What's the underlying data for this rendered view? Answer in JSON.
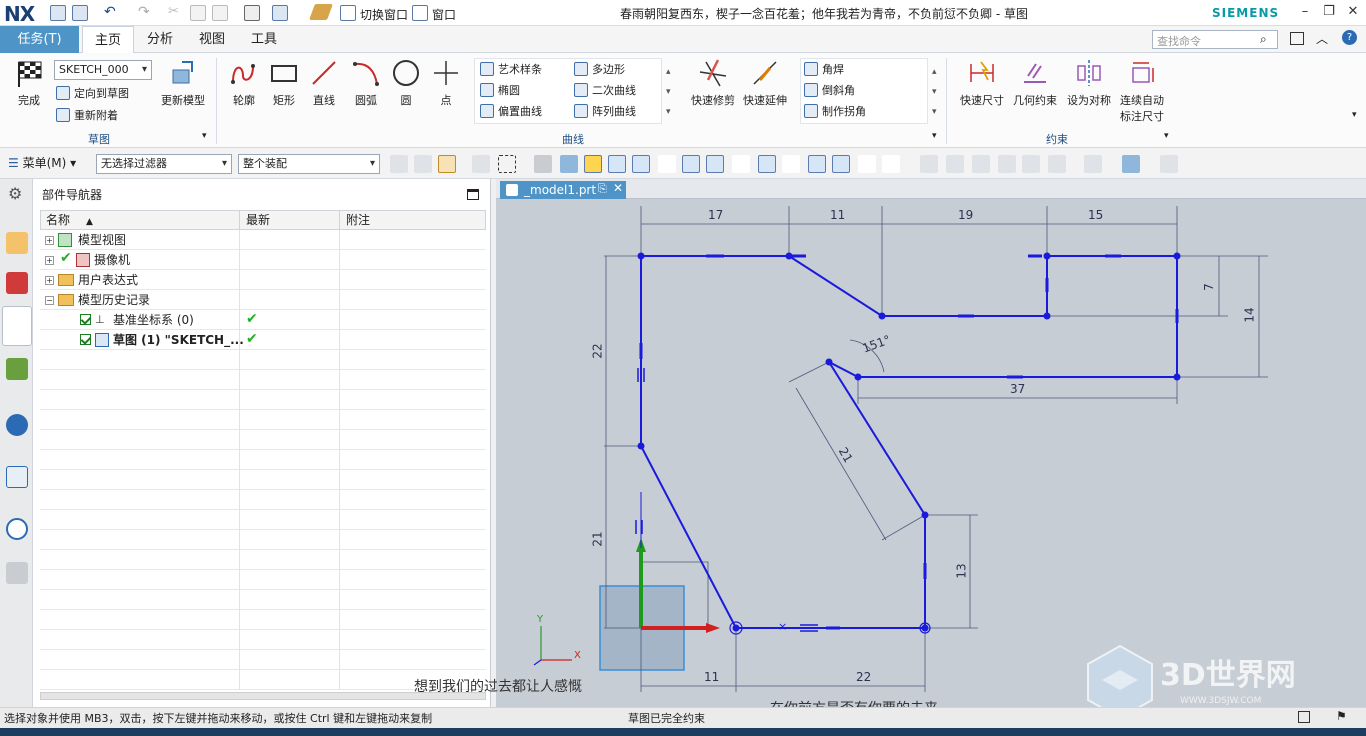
{
  "titlebar": {
    "logo": "NX",
    "switch_window": "切换窗口",
    "window_menu": "窗口",
    "title": "春雨朝阳复西东，楔子一念百花羞；他年我若为青帝，不负前愆不负卿 - 草图",
    "brand": "SIEMENS"
  },
  "menubar": {
    "task": "任务(T)",
    "tabs": [
      "主页",
      "分析",
      "视图",
      "工具"
    ],
    "search_placeholder": "查找命令"
  },
  "ribbon": {
    "finish": "完成",
    "sketch_name": "SKETCH_000",
    "orient_to_sketch": "定向到草图",
    "reattach": "重新附着",
    "update_model": "更新模型",
    "group_sketch": "草图",
    "profile": "轮廓",
    "rectangle": "矩形",
    "line": "直线",
    "arc": "圆弧",
    "circle": "圆",
    "point": "点",
    "studio_spline": "艺术样条",
    "polygon": "多边形",
    "ellipse": "椭圆",
    "conic": "二次曲线",
    "offset_curve": "偏置曲线",
    "pattern_curve": "阵列曲线",
    "quick_trim": "快速修剪",
    "quick_extend": "快速延伸",
    "fillet": "角焊",
    "chamfer": "倒斜角",
    "make_corner": "制作拐角",
    "group_curve": "曲线",
    "rapid_dimension": "快速尺寸",
    "geometric_constraints": "几何约束",
    "make_symmetric": "设为对称",
    "continuous_auto_dim_1": "连续自动",
    "continuous_auto_dim_2": "标注尺寸",
    "group_constraint": "约束"
  },
  "selbar": {
    "menu": "菜单(M)",
    "filter": "无选择过滤器",
    "scope": "整个装配"
  },
  "navigator": {
    "title": "部件导航器",
    "columns": [
      "名称",
      "最新",
      "附注"
    ],
    "rows": [
      {
        "label": "模型视图",
        "toggle": "+"
      },
      {
        "label": "摄像机",
        "toggle": "+"
      },
      {
        "label": "用户表达式",
        "toggle": "+"
      },
      {
        "label": "模型历史记录",
        "toggle": "−"
      },
      {
        "label": "基准坐标系 (0)",
        "latest": "✔"
      },
      {
        "label": "草图 (1) \"SKETCH_...",
        "latest": "✔"
      }
    ]
  },
  "doc_tab": "_model1.prt",
  "dimensions": {
    "d17": "17",
    "d11_top": "11",
    "d19": "19",
    "d15": "15",
    "d7": "7",
    "d14": "14",
    "d22_left": "22",
    "d21_left": "21",
    "d151": "151°",
    "d37": "37",
    "d21_diag": "21",
    "d13": "13",
    "d11_bottom": "11",
    "d22_bottom": "22"
  },
  "axes": {
    "x": "X",
    "y": "Y"
  },
  "subtitles": {
    "line1": "想到我们的过去都让人感慨",
    "line2": "在你前方是否有你要的未来"
  },
  "watermark": {
    "brand": "3D世界网",
    "url": "WWW.3DSJW.COM"
  },
  "status": {
    "hint": "选择对象并使用 MB3，双击，按下左键并拖动来移动，或按住 Ctrl 键和左键拖动来复制",
    "state": "草图已完全约束"
  },
  "colors": {
    "accent": "#4f94c7",
    "sketch": "#1a1adc",
    "brand": "#0a9aa5"
  }
}
